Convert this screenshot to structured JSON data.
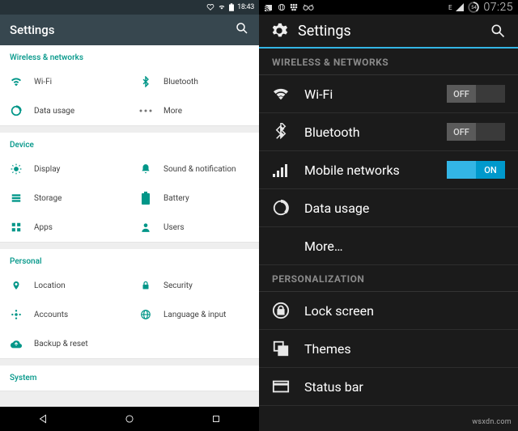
{
  "left": {
    "status": {
      "time": "18:43"
    },
    "title": "Settings",
    "categories": [
      {
        "name": "Wireless & networks",
        "items": [
          {
            "id": "wifi",
            "icon": "wifi-icon",
            "label": "Wi-Fi"
          },
          {
            "id": "bluetooth",
            "icon": "bluetooth-icon",
            "label": "Bluetooth"
          },
          {
            "id": "data",
            "icon": "data-usage-icon",
            "label": "Data usage"
          },
          {
            "id": "more",
            "icon": "more-icon",
            "label": "More"
          }
        ]
      },
      {
        "name": "Device",
        "items": [
          {
            "id": "display",
            "icon": "display-icon",
            "label": "Display"
          },
          {
            "id": "sound",
            "icon": "bell-icon",
            "label": "Sound & notification"
          },
          {
            "id": "storage",
            "icon": "storage-icon",
            "label": "Storage"
          },
          {
            "id": "battery",
            "icon": "battery-icon",
            "label": "Battery"
          },
          {
            "id": "apps",
            "icon": "apps-icon",
            "label": "Apps"
          },
          {
            "id": "users",
            "icon": "users-icon",
            "label": "Users"
          }
        ]
      },
      {
        "name": "Personal",
        "items": [
          {
            "id": "location",
            "icon": "location-icon",
            "label": "Location"
          },
          {
            "id": "security",
            "icon": "lock-icon",
            "label": "Security"
          },
          {
            "id": "accounts",
            "icon": "accounts-icon",
            "label": "Accounts"
          },
          {
            "id": "language",
            "icon": "language-icon",
            "label": "Language & input"
          },
          {
            "id": "backup",
            "icon": "backup-icon",
            "label": "Backup & reset",
            "full": true
          }
        ]
      },
      {
        "name": "System",
        "items": []
      }
    ]
  },
  "right": {
    "status": {
      "cell": "E",
      "battery": "54",
      "time": "07:25"
    },
    "title": "Settings",
    "sections": [
      {
        "name": "WIRELESS & NETWORKS",
        "rows": [
          {
            "id": "wifi",
            "icon": "wifi-icon",
            "label": "Wi-Fi",
            "toggle": "OFF"
          },
          {
            "id": "bluetooth",
            "icon": "bluetooth-icon",
            "label": "Bluetooth",
            "toggle": "OFF"
          },
          {
            "id": "mobile",
            "icon": "signal-icon",
            "label": "Mobile networks",
            "toggle": "ON"
          },
          {
            "id": "data",
            "icon": "data-usage-icon",
            "label": "Data usage"
          },
          {
            "id": "more",
            "icon": "",
            "label": "More…"
          }
        ]
      },
      {
        "name": "PERSONALIZATION",
        "rows": [
          {
            "id": "lock",
            "icon": "lock-circle-icon",
            "label": "Lock screen"
          },
          {
            "id": "themes",
            "icon": "themes-icon",
            "label": "Themes"
          },
          {
            "id": "status",
            "icon": "statusbar-icon",
            "label": "Status bar"
          }
        ]
      }
    ]
  },
  "watermark": "wsxdn.com"
}
